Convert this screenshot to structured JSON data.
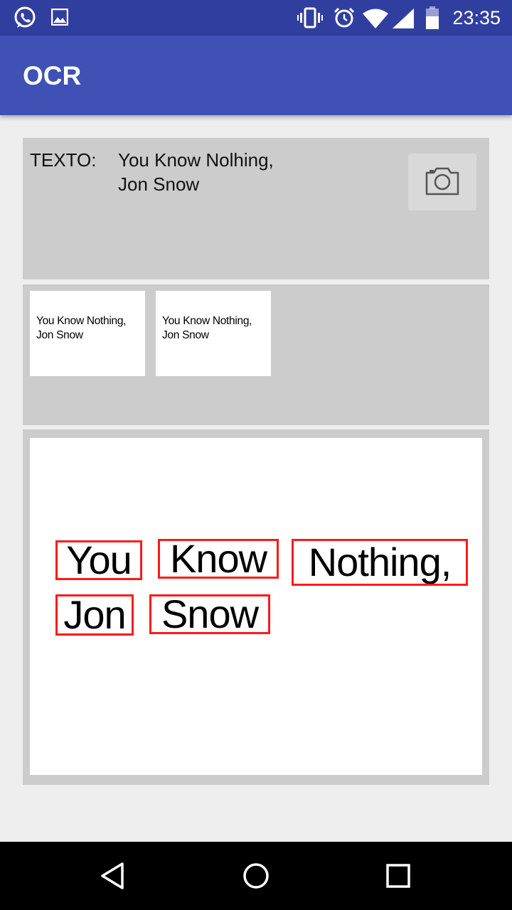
{
  "status_bar": {
    "time": "23:35",
    "left_icons": [
      "whatsapp-icon",
      "image-icon"
    ],
    "right_icons": [
      "vibrate-icon",
      "alarm-icon",
      "wifi-icon",
      "signal-icon",
      "battery-icon"
    ]
  },
  "app_bar": {
    "title": "OCR"
  },
  "result": {
    "label": "TEXTO:",
    "lines": [
      "You Know Nolhing,",
      "Jon Snow"
    ],
    "camera_icon": "camera-icon"
  },
  "thumbnails": [
    {
      "line1": "You Know Nothing,",
      "line2": "Jon Snow"
    },
    {
      "line1": "You Know Nothing,",
      "line2": "Jon Snow"
    }
  ],
  "preview": {
    "box_color": "#ff1a1a",
    "words": [
      "You",
      "Know",
      "Nothing,",
      "Jon",
      "Snow"
    ]
  },
  "nav_bar": {
    "icons": [
      "back-icon",
      "home-icon",
      "recents-icon"
    ]
  },
  "colors": {
    "app_bar": "#3f51b5",
    "status_bar": "#303f9f",
    "panel": "#cccccc"
  }
}
